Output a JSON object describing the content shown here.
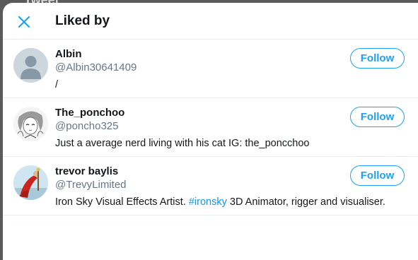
{
  "backdrop": {
    "top_text": "Tweet"
  },
  "modal": {
    "title": "Liked by",
    "close_icon": "close-icon"
  },
  "users": [
    {
      "name": "Albin",
      "handle": "@Albin30641409",
      "bio": "/",
      "follow_label": "Follow",
      "avatar_icon": "default-avatar-icon"
    },
    {
      "name": "The_ponchoo",
      "handle": "@poncho325",
      "bio": "Just a average nerd living with his cat IG: the_poncchoo",
      "follow_label": "Follow",
      "avatar_icon": "anime-sketch-avatar"
    },
    {
      "name": "trevor baylis",
      "handle": "@TrevyLimited",
      "bio_before": "Iron Sky Visual Effects Artist. ",
      "bio_hashtag": "#ironsky",
      "bio_after": " 3D Animator, rigger and visualiser.",
      "follow_label": "Follow",
      "avatar_icon": "red-cape-hero-avatar"
    }
  ],
  "colors": {
    "accent": "#1da1f2",
    "hashtag": "#1b95e0",
    "text_primary": "#14171a",
    "text_secondary": "#657786",
    "divider": "#e6ecf0",
    "overlay": "#5b5b5b"
  }
}
